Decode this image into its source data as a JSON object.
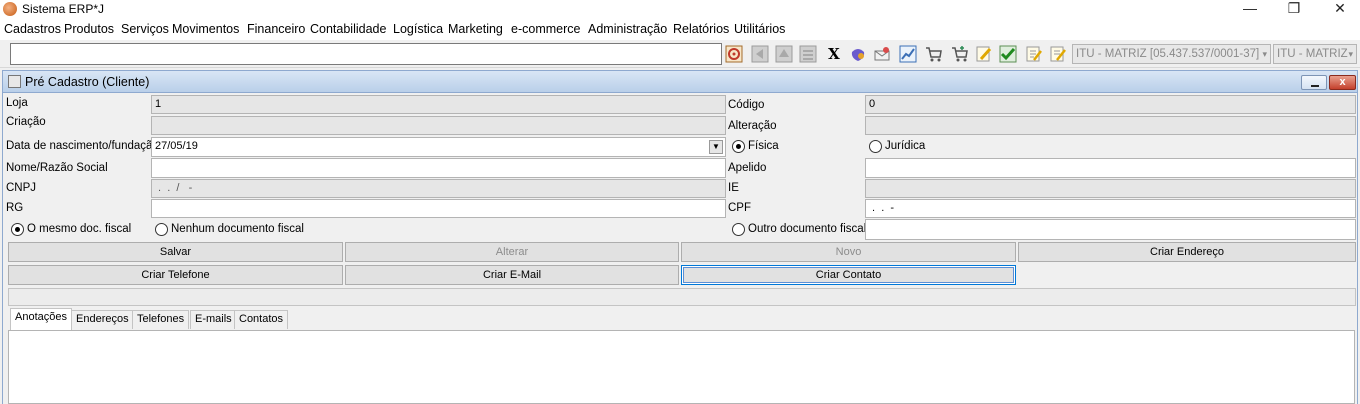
{
  "window": {
    "title": "Sistema ERP*J",
    "minimize": "—",
    "maximize": "❐",
    "close": "✕"
  },
  "menu": [
    "Cadastros",
    "Produtos",
    "Serviços",
    "Movimentos",
    "Financeiro",
    "Contabilidade",
    "Logística",
    "Marketing",
    "e-commerce",
    "Administração",
    "Relatórios",
    "Utilitários"
  ],
  "toolbar": {
    "x_label": "X",
    "company_combo": "ITU - MATRIZ [05.437.537/0001-37]",
    "branch_combo": "ITU - MATRIZ",
    "combo_arrow": "▾"
  },
  "frame": {
    "title": "Pré Cadastro (Cliente)",
    "close": "x"
  },
  "form": {
    "loja_label": "Loja",
    "loja_value": "1",
    "codigo_label": "Código",
    "codigo_value": "0",
    "criacao_label": "Criação",
    "alteracao_label": "Alteração",
    "nascimento_label": "Data de nascimento/fundação",
    "nascimento_value": "27/05/19",
    "fisica_label": "Física",
    "juridica_label": "Jurídica",
    "nome_label": "Nome/Razão Social",
    "apelido_label": "Apelido",
    "cnpj_label": "CNPJ",
    "cnpj_mask": " .  .  /   -",
    "ie_label": "IE",
    "rg_label": "RG",
    "cpf_label": "CPF",
    "cpf_mask": " .  .  -",
    "mesmo_doc_label": "O mesmo doc. fiscal",
    "nenhum_doc_label": "Nenhum documento fiscal",
    "outro_doc_label": "Outro documento fiscal"
  },
  "buttons": {
    "salvar": "Salvar",
    "alterar": "Alterar",
    "novo": "Novo",
    "criar_endereco": "Criar Endereço",
    "criar_telefone": "Criar Telefone",
    "criar_email": "Criar E-Mail",
    "criar_contato": "Criar Contato"
  },
  "tabs": [
    "Anotações",
    "Endereços",
    "Telefones",
    "E-mails",
    "Contatos"
  ]
}
